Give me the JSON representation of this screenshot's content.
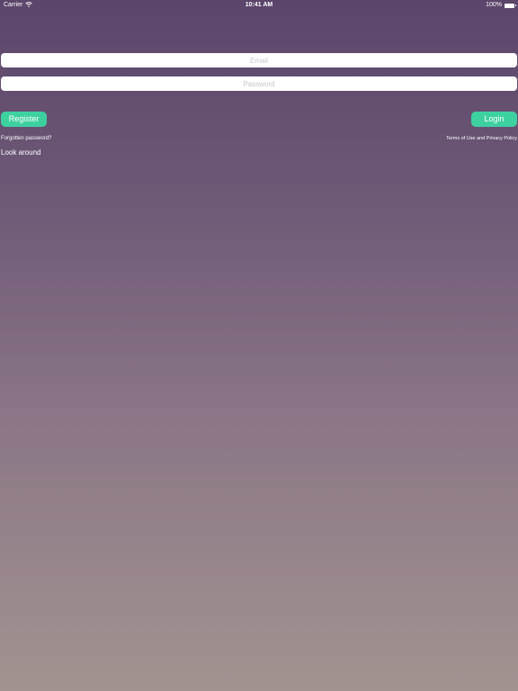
{
  "status_bar": {
    "carrier": "Carrier",
    "wifi_icon": "wifi-icon",
    "time": "10:41 AM",
    "battery_percent": "100%",
    "battery_icon": "battery-icon"
  },
  "login_form": {
    "email": {
      "value": "",
      "placeholder": "Email"
    },
    "password": {
      "value": "",
      "placeholder": "Password"
    },
    "register_label": "Register",
    "login_label": "Login",
    "forgot_password_label": "Forgotten password?",
    "terms_label": "Terms of Use and Privacy Policy",
    "look_around_label": "Look around"
  },
  "colors": {
    "accent": "#3ed1a0",
    "background_top": "#5b456b",
    "background_bottom": "#a29390",
    "text": "#ffffff"
  }
}
